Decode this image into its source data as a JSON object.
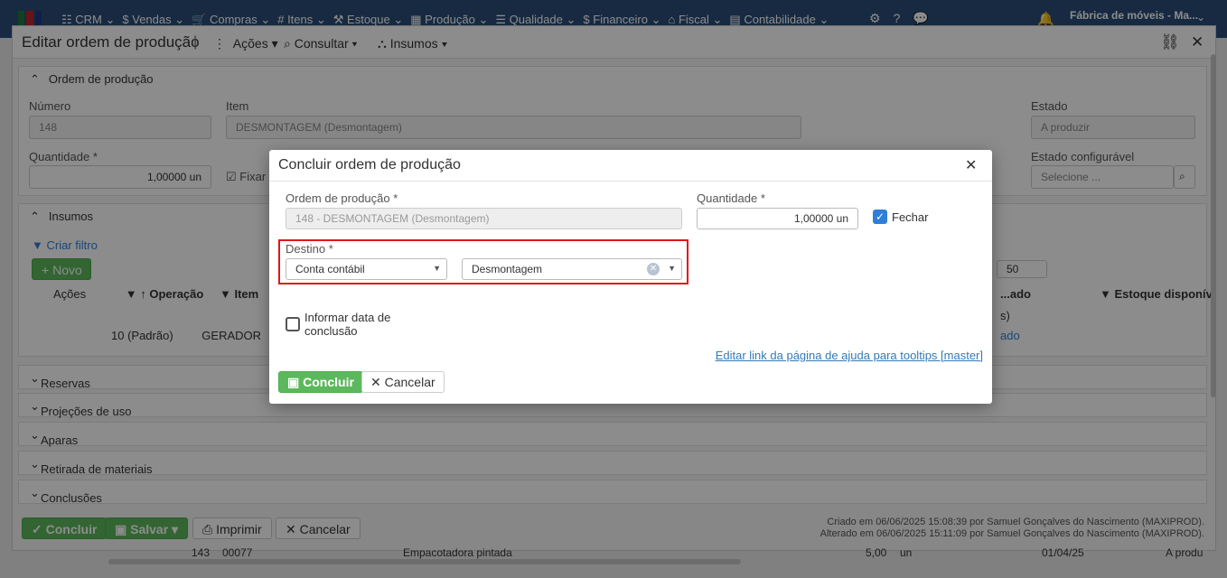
{
  "topnav": {
    "items": [
      "CRM",
      "Vendas",
      "Compras",
      "Itens",
      "Estoque",
      "Produção",
      "Qualidade",
      "Financeiro",
      "Fiscal",
      "Contabilidade"
    ],
    "company": "Fábrica de móveis - Ma..."
  },
  "window": {
    "title": "Editar ordem de produção",
    "menus": [
      "Ações",
      "Consultar",
      "Insumos"
    ]
  },
  "ordem": {
    "section_title": "Ordem de produção",
    "numero_label": "Número",
    "numero_value": "148",
    "item_label": "Item",
    "item_value": "DESMONTAGEM (Desmontagem)",
    "estado_label": "Estado",
    "estado_placeholder": "A produzir",
    "quantidade_label": "Quantidade *",
    "quantidade_value": "1,00000 un",
    "fixar_label": "Fixar",
    "estado_config_label": "Estado configurável",
    "estado_config_placeholder": "Selecione ..."
  },
  "insumos": {
    "section_title": "Insumos",
    "criar_filtro": "Criar filtro",
    "novo": "Novo",
    "page_size": "50",
    "columns": [
      "Ações",
      "Operação",
      "Item",
      "...ado",
      "Estoque disponív"
    ],
    "row": {
      "operacao": "10 (Padrão)",
      "item": "GERADOR",
      "status_tail": "ado",
      "filter_tail": "s)"
    }
  },
  "sections": [
    "Reservas",
    "Projeções de uso",
    "Aparas",
    "Retirada de materiais",
    "Conclusões"
  ],
  "footer": {
    "concluir": "Concluir",
    "salvar": "Salvar",
    "imprimir": "Imprimir",
    "cancelar": "Cancelar",
    "criado": "Criado em 06/06/2025 15:08:39 por Samuel Gonçalves do Nascimento (MAXIPROD).",
    "alterado": "Alterado em 06/06/2025 15:11:09 por Samuel Gonçalves do Nascimento (MAXIPROD)."
  },
  "background_row": {
    "num": "143",
    "code": "00077",
    "desc": "Empacotadora pintada",
    "qty": "5,00",
    "unit": "un",
    "date": "01/04/25",
    "status": "A produ"
  },
  "modal": {
    "title": "Concluir ordem de produção",
    "ordem_label": "Ordem de produção *",
    "ordem_value": "148 - DESMONTAGEM (Desmontagem)",
    "quantidade_label": "Quantidade *",
    "quantidade_value": "1,00000 un",
    "fechar_label": "Fechar",
    "fechar_checked": true,
    "destino_label": "Destino *",
    "destino_tipo": "Conta contábil",
    "destino_valor": "Desmontagem",
    "informar_data_line1": "Informar data de",
    "informar_data_line2": "conclusão",
    "informar_data_checked": false,
    "help_link": "Editar link da página de ajuda para tooltips [master]",
    "concluir_button": "Concluir",
    "cancelar_button": "Cancelar"
  },
  "colors": {
    "nav": "#2a4e78",
    "primary_green": "#5cb85c",
    "checkbox_blue": "#2f7ed8",
    "highlight_red": "#e0161c",
    "link_blue": "#337ab7"
  }
}
